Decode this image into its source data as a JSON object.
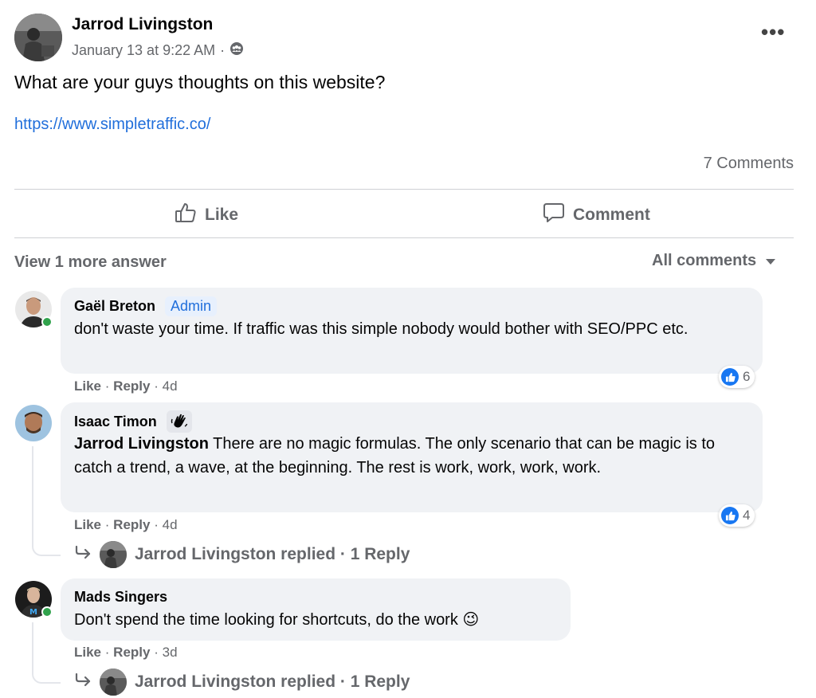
{
  "post": {
    "author": "Jarrod Livingston",
    "timestamp": "January 13 at 9:22 AM",
    "meta_separator": "·",
    "audience_icon": "group-audience-icon",
    "more_icon": "more-options-icon",
    "more_label": "•••",
    "text": "What are your guys thoughts on this website?",
    "link": "https://www.simpletraffic.co/",
    "comments_count": "7 Comments"
  },
  "actions": {
    "like": "Like",
    "comment": "Comment"
  },
  "comments_header": {
    "view_more": "View 1 more answer",
    "sort": "All comments"
  },
  "comments": [
    {
      "name": "Gaël Breton",
      "badge": "Admin",
      "text": "don't waste your time. If traffic was this simple nobody would bother with SEO/PPC etc.",
      "like": "Like",
      "reply": "Reply",
      "age": "4d",
      "reactions": "6",
      "online": true
    },
    {
      "name": "Isaac Timon",
      "badge_icon": "waving-hand-icon",
      "mention": "Jarrod Livingston",
      "text": " There are no magic formulas. The only scenario that can be magic is to catch a trend, a wave, at the beginning. The rest is work, work, work, work.",
      "like": "Like",
      "reply": "Reply",
      "age": "4d",
      "reactions": "4",
      "replies_summary": "Jarrod Livingston replied · 1 Reply"
    },
    {
      "name": "Mads Singers",
      "text": "Don't spend the time looking for shortcuts, do the work",
      "emoji": "😉",
      "like": "Like",
      "reply": "Reply",
      "age": "3d",
      "online": true,
      "replies_summary": "Jarrod Livingston replied · 1 Reply"
    }
  ],
  "separators": {
    "dot": "·"
  },
  "colors": {
    "link": "#216fdb",
    "secondary_text": "#65676b",
    "bubble": "#f0f2f5",
    "like_blue": "#1877f2",
    "online_green": "#31a24c",
    "admin_badge_bg": "#e7f0fd"
  }
}
